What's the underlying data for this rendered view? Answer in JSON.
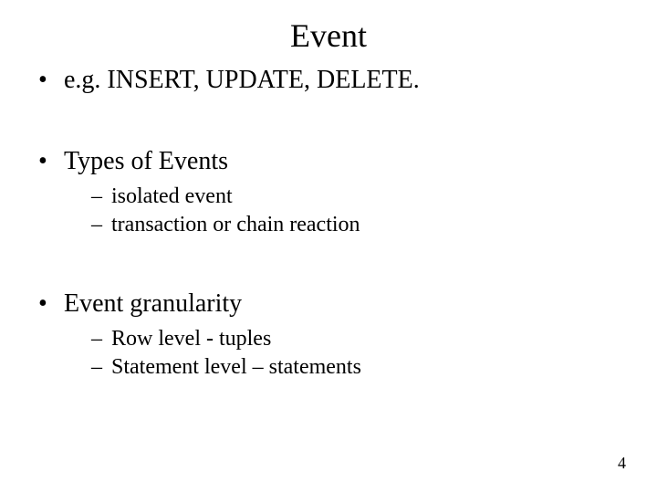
{
  "title": "Event",
  "bullets": [
    {
      "text": "e.g. INSERT, UPDATE, DELETE.",
      "sub": []
    },
    {
      "text": "Types of Events",
      "sub": [
        "isolated event",
        "transaction or chain reaction"
      ]
    },
    {
      "text": "Event granularity",
      "sub": [
        "Row level  - tuples",
        "Statement level – statements"
      ]
    }
  ],
  "page_number": "4"
}
